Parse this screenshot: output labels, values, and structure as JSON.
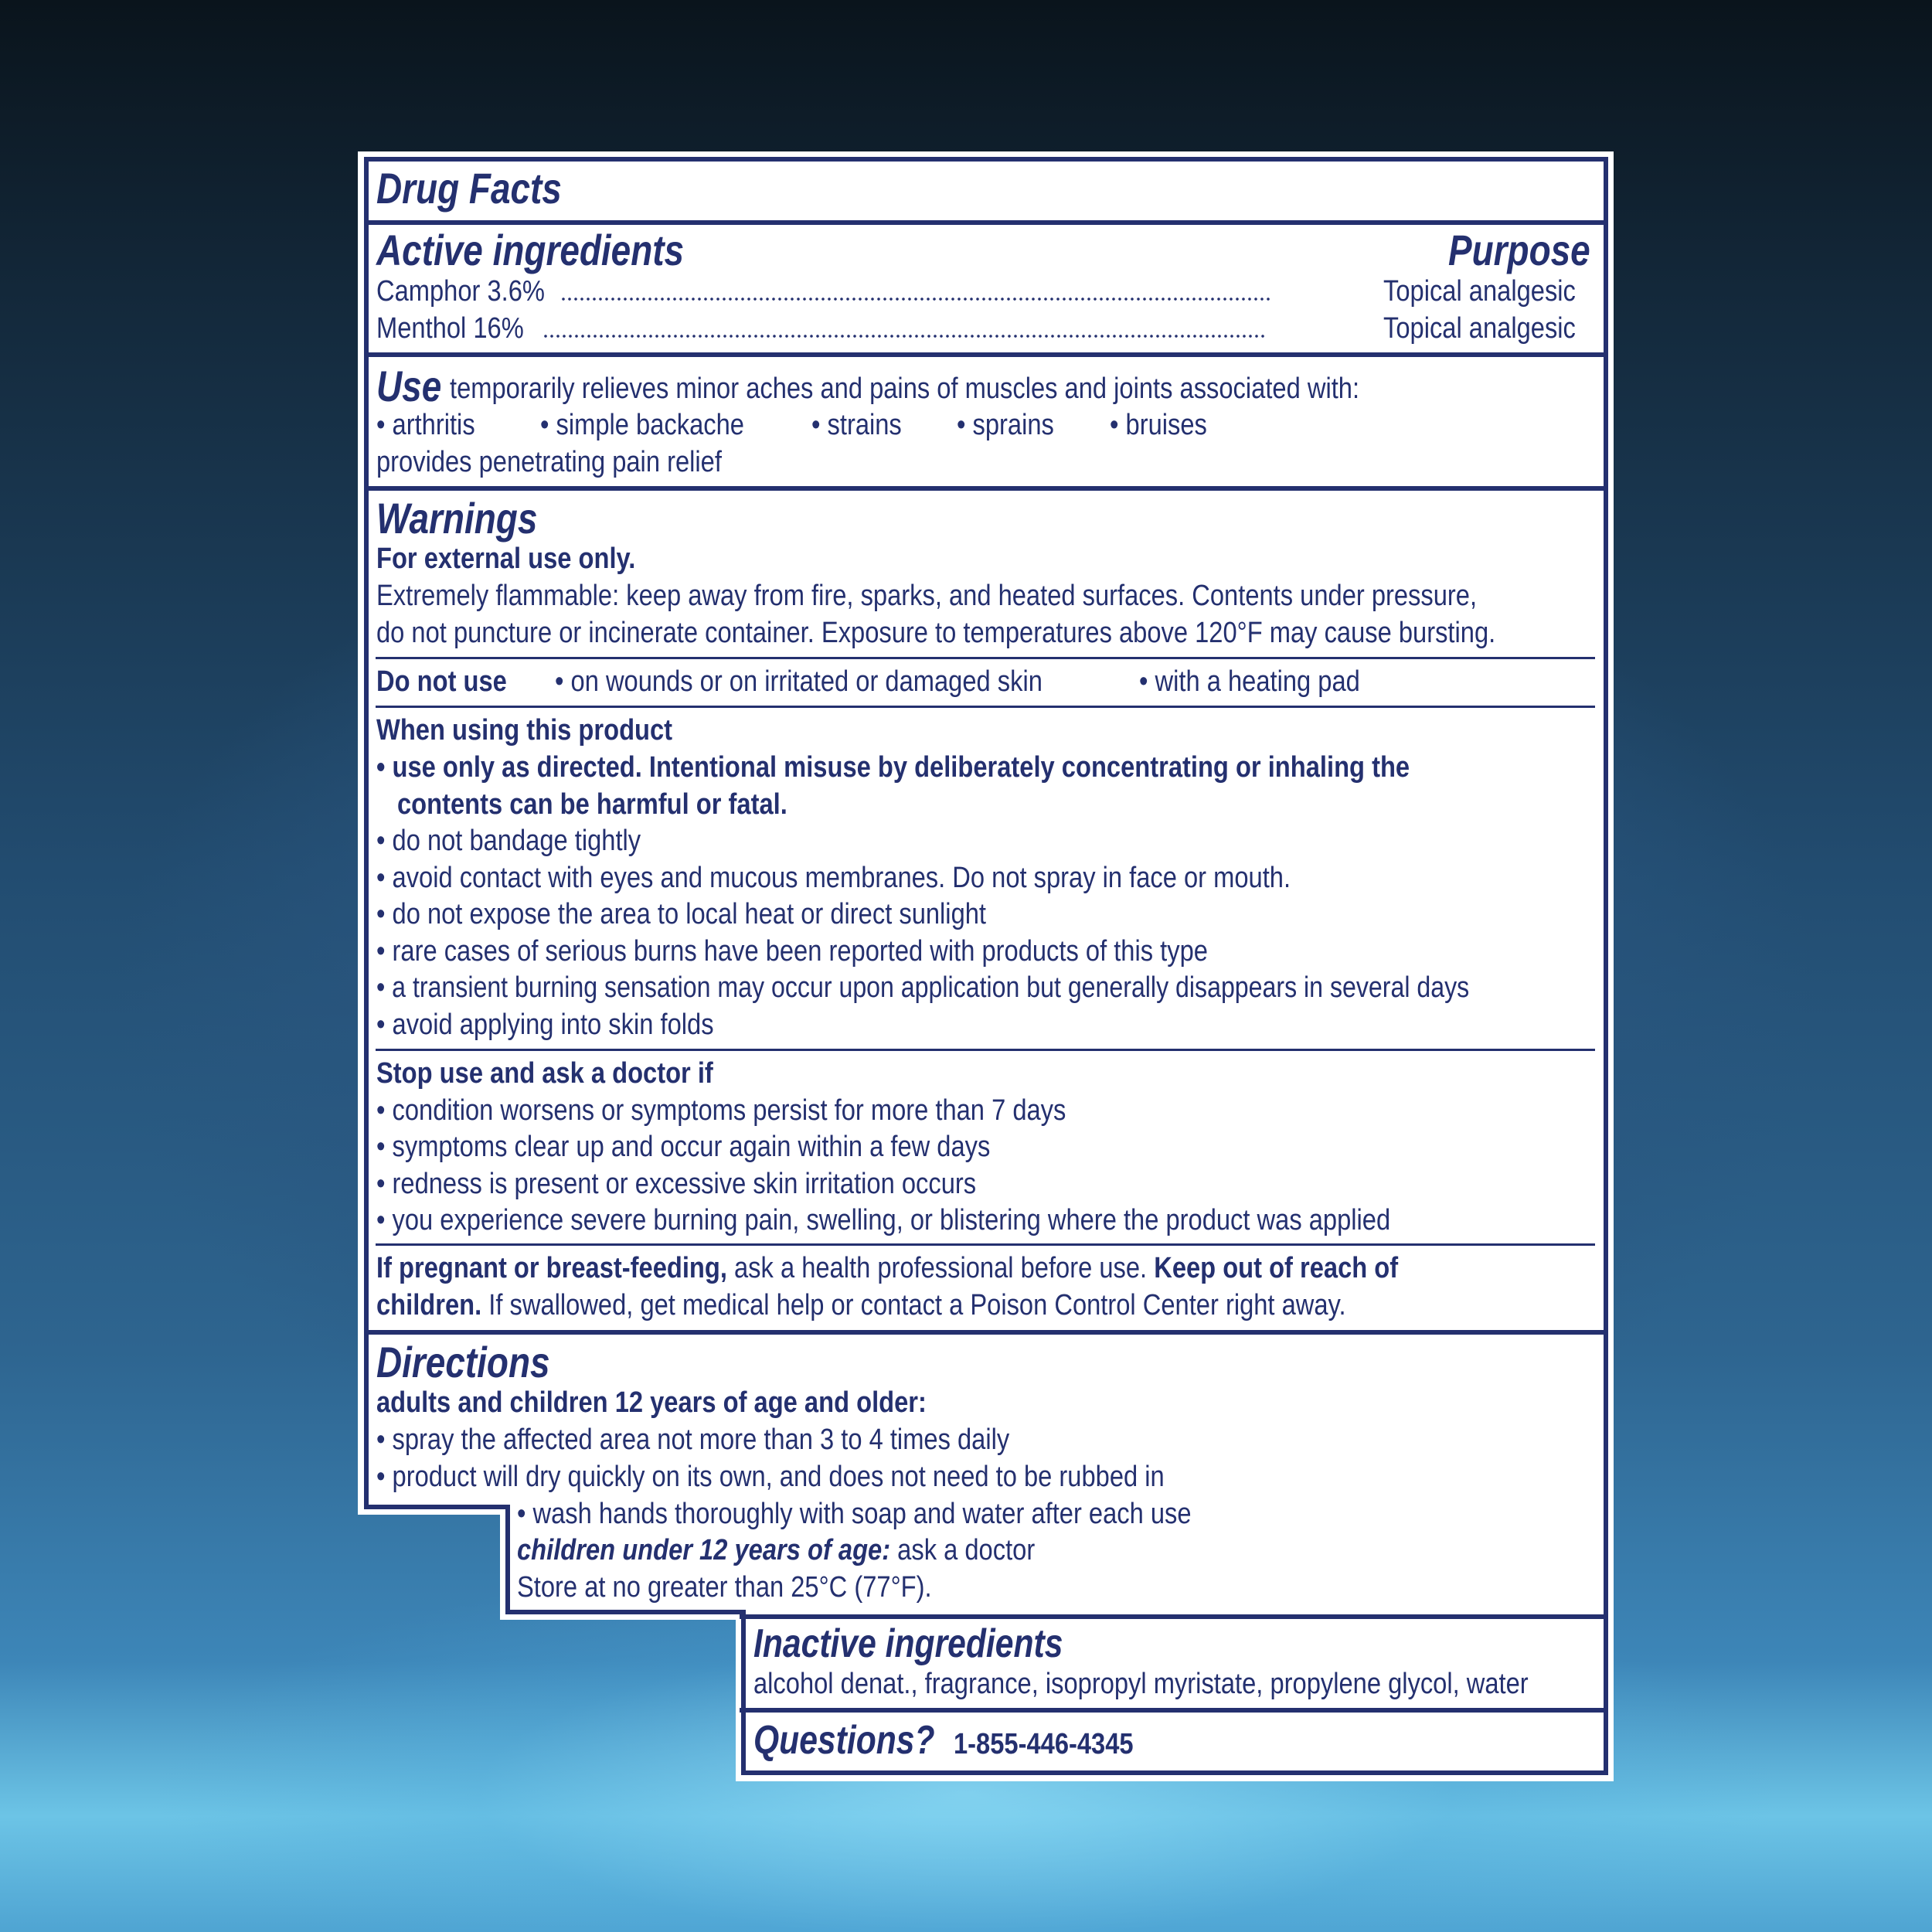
{
  "title": "Drug Facts",
  "active": {
    "heading": "Active ingredients",
    "purpose_heading": "Purpose",
    "items": [
      {
        "name": "Camphor 3.6%",
        "purpose": "Topical analgesic"
      },
      {
        "name": "Menthol 16%",
        "purpose": "Topical analgesic"
      }
    ]
  },
  "use": {
    "heading": "Use",
    "text": "temporarily relieves minor aches and pains of muscles and joints associated with:",
    "bullets": [
      "• arthritis",
      "• simple backache",
      "• strains",
      "• sprains",
      "• bruises"
    ],
    "extra": "provides penetrating pain relief"
  },
  "warnings": {
    "heading": "Warnings",
    "external": "For external use only.",
    "flammable_1": "Extremely flammable: keep away from fire, sparks, and heated surfaces. Contents under pressure,",
    "flammable_2": "do not puncture or incinerate container. Exposure to temperatures above 120°F may cause bursting.",
    "do_not_use": {
      "label": "Do not use",
      "items": [
        "• on wounds or on irritated or damaged skin",
        "• with a heating pad"
      ]
    },
    "when_using": {
      "label": "When using this product",
      "bold_1": "• use only as directed. Intentional misuse by deliberately concentrating or inhaling the",
      "bold_2": "contents can be harmful or fatal.",
      "items": [
        "• do not bandage tightly",
        "• avoid contact with eyes and mucous membranes. Do not spray in face or mouth.",
        "• do not expose the area to local heat or direct sunlight",
        "• rare cases of serious burns have been reported with products of this type",
        "• a transient burning sensation may occur upon application but generally disappears in several days",
        "• avoid applying into skin folds"
      ]
    },
    "stop_use": {
      "label": "Stop use and ask a doctor if",
      "items": [
        "• condition worsens or symptoms persist for more than 7 days",
        "• symptoms clear up and occur again within a few days",
        "• redness is present or excessive skin irritation occurs",
        "• you experience severe burning pain, swelling, or blistering where the product was applied"
      ]
    },
    "pregnant": {
      "bold": "If pregnant or breast-feeding,",
      "text": " ask a health professional before use. ",
      "bold2": "Keep out of reach of",
      "bold3": "children.",
      "text2": " If swallowed, get medical help or contact a Poison Control Center right away."
    }
  },
  "directions": {
    "heading": "Directions",
    "adults": "adults and children 12 years of age and older:",
    "items": [
      "• spray the affected area not more than 3 to 4 times daily",
      "• product will dry quickly on its own, and does not need to be rubbed in",
      "• wash hands thoroughly with soap and water after each use"
    ],
    "children_label": "children under 12 years of age:",
    "children_text": " ask a doctor",
    "store": "Store at no greater than 25°C (77°F)."
  },
  "inactive": {
    "heading": "Inactive ingredients",
    "text": "alcohol denat., fragrance, isopropyl myristate, propylene glycol, water"
  },
  "questions": {
    "heading": "Questions?",
    "phone": "1-855-446-4345"
  },
  "colors": {
    "ink": "#24306f",
    "label_bg": "#ffffff"
  }
}
